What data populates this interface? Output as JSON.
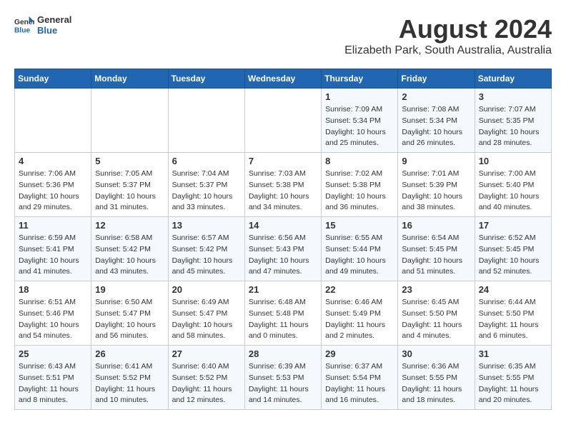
{
  "header": {
    "logo_general": "General",
    "logo_blue": "Blue",
    "month_year": "August 2024",
    "location": "Elizabeth Park, South Australia, Australia"
  },
  "weekdays": [
    "Sunday",
    "Monday",
    "Tuesday",
    "Wednesday",
    "Thursday",
    "Friday",
    "Saturday"
  ],
  "weeks": [
    [
      {
        "day": "",
        "sunrise": "",
        "sunset": "",
        "daylight": ""
      },
      {
        "day": "",
        "sunrise": "",
        "sunset": "",
        "daylight": ""
      },
      {
        "day": "",
        "sunrise": "",
        "sunset": "",
        "daylight": ""
      },
      {
        "day": "",
        "sunrise": "",
        "sunset": "",
        "daylight": ""
      },
      {
        "day": "1",
        "sunrise": "Sunrise: 7:09 AM",
        "sunset": "Sunset: 5:34 PM",
        "daylight": "Daylight: 10 hours and 25 minutes."
      },
      {
        "day": "2",
        "sunrise": "Sunrise: 7:08 AM",
        "sunset": "Sunset: 5:34 PM",
        "daylight": "Daylight: 10 hours and 26 minutes."
      },
      {
        "day": "3",
        "sunrise": "Sunrise: 7:07 AM",
        "sunset": "Sunset: 5:35 PM",
        "daylight": "Daylight: 10 hours and 28 minutes."
      }
    ],
    [
      {
        "day": "4",
        "sunrise": "Sunrise: 7:06 AM",
        "sunset": "Sunset: 5:36 PM",
        "daylight": "Daylight: 10 hours and 29 minutes."
      },
      {
        "day": "5",
        "sunrise": "Sunrise: 7:05 AM",
        "sunset": "Sunset: 5:37 PM",
        "daylight": "Daylight: 10 hours and 31 minutes."
      },
      {
        "day": "6",
        "sunrise": "Sunrise: 7:04 AM",
        "sunset": "Sunset: 5:37 PM",
        "daylight": "Daylight: 10 hours and 33 minutes."
      },
      {
        "day": "7",
        "sunrise": "Sunrise: 7:03 AM",
        "sunset": "Sunset: 5:38 PM",
        "daylight": "Daylight: 10 hours and 34 minutes."
      },
      {
        "day": "8",
        "sunrise": "Sunrise: 7:02 AM",
        "sunset": "Sunset: 5:38 PM",
        "daylight": "Daylight: 10 hours and 36 minutes."
      },
      {
        "day": "9",
        "sunrise": "Sunrise: 7:01 AM",
        "sunset": "Sunset: 5:39 PM",
        "daylight": "Daylight: 10 hours and 38 minutes."
      },
      {
        "day": "10",
        "sunrise": "Sunrise: 7:00 AM",
        "sunset": "Sunset: 5:40 PM",
        "daylight": "Daylight: 10 hours and 40 minutes."
      }
    ],
    [
      {
        "day": "11",
        "sunrise": "Sunrise: 6:59 AM",
        "sunset": "Sunset: 5:41 PM",
        "daylight": "Daylight: 10 hours and 41 minutes."
      },
      {
        "day": "12",
        "sunrise": "Sunrise: 6:58 AM",
        "sunset": "Sunset: 5:42 PM",
        "daylight": "Daylight: 10 hours and 43 minutes."
      },
      {
        "day": "13",
        "sunrise": "Sunrise: 6:57 AM",
        "sunset": "Sunset: 5:42 PM",
        "daylight": "Daylight: 10 hours and 45 minutes."
      },
      {
        "day": "14",
        "sunrise": "Sunrise: 6:56 AM",
        "sunset": "Sunset: 5:43 PM",
        "daylight": "Daylight: 10 hours and 47 minutes."
      },
      {
        "day": "15",
        "sunrise": "Sunrise: 6:55 AM",
        "sunset": "Sunset: 5:44 PM",
        "daylight": "Daylight: 10 hours and 49 minutes."
      },
      {
        "day": "16",
        "sunrise": "Sunrise: 6:54 AM",
        "sunset": "Sunset: 5:45 PM",
        "daylight": "Daylight: 10 hours and 51 minutes."
      },
      {
        "day": "17",
        "sunrise": "Sunrise: 6:52 AM",
        "sunset": "Sunset: 5:45 PM",
        "daylight": "Daylight: 10 hours and 52 minutes."
      }
    ],
    [
      {
        "day": "18",
        "sunrise": "Sunrise: 6:51 AM",
        "sunset": "Sunset: 5:46 PM",
        "daylight": "Daylight: 10 hours and 54 minutes."
      },
      {
        "day": "19",
        "sunrise": "Sunrise: 6:50 AM",
        "sunset": "Sunset: 5:47 PM",
        "daylight": "Daylight: 10 hours and 56 minutes."
      },
      {
        "day": "20",
        "sunrise": "Sunrise: 6:49 AM",
        "sunset": "Sunset: 5:47 PM",
        "daylight": "Daylight: 10 hours and 58 minutes."
      },
      {
        "day": "21",
        "sunrise": "Sunrise: 6:48 AM",
        "sunset": "Sunset: 5:48 PM",
        "daylight": "Daylight: 11 hours and 0 minutes."
      },
      {
        "day": "22",
        "sunrise": "Sunrise: 6:46 AM",
        "sunset": "Sunset: 5:49 PM",
        "daylight": "Daylight: 11 hours and 2 minutes."
      },
      {
        "day": "23",
        "sunrise": "Sunrise: 6:45 AM",
        "sunset": "Sunset: 5:50 PM",
        "daylight": "Daylight: 11 hours and 4 minutes."
      },
      {
        "day": "24",
        "sunrise": "Sunrise: 6:44 AM",
        "sunset": "Sunset: 5:50 PM",
        "daylight": "Daylight: 11 hours and 6 minutes."
      }
    ],
    [
      {
        "day": "25",
        "sunrise": "Sunrise: 6:43 AM",
        "sunset": "Sunset: 5:51 PM",
        "daylight": "Daylight: 11 hours and 8 minutes."
      },
      {
        "day": "26",
        "sunrise": "Sunrise: 6:41 AM",
        "sunset": "Sunset: 5:52 PM",
        "daylight": "Daylight: 11 hours and 10 minutes."
      },
      {
        "day": "27",
        "sunrise": "Sunrise: 6:40 AM",
        "sunset": "Sunset: 5:52 PM",
        "daylight": "Daylight: 11 hours and 12 minutes."
      },
      {
        "day": "28",
        "sunrise": "Sunrise: 6:39 AM",
        "sunset": "Sunset: 5:53 PM",
        "daylight": "Daylight: 11 hours and 14 minutes."
      },
      {
        "day": "29",
        "sunrise": "Sunrise: 6:37 AM",
        "sunset": "Sunset: 5:54 PM",
        "daylight": "Daylight: 11 hours and 16 minutes."
      },
      {
        "day": "30",
        "sunrise": "Sunrise: 6:36 AM",
        "sunset": "Sunset: 5:55 PM",
        "daylight": "Daylight: 11 hours and 18 minutes."
      },
      {
        "day": "31",
        "sunrise": "Sunrise: 6:35 AM",
        "sunset": "Sunset: 5:55 PM",
        "daylight": "Daylight: 11 hours and 20 minutes."
      }
    ]
  ]
}
